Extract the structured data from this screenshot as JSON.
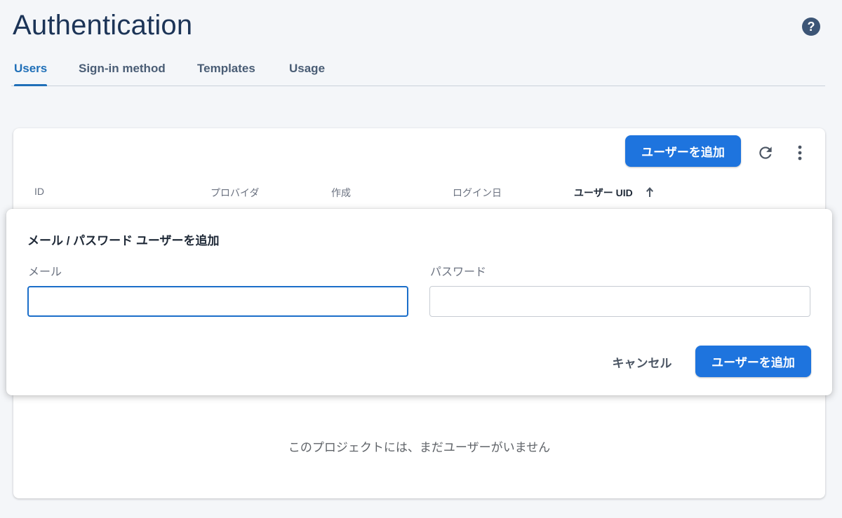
{
  "header": {
    "title": "Authentication",
    "help_icon": "?"
  },
  "tabs": [
    {
      "label": "Users",
      "active": true
    },
    {
      "label": "Sign-in method",
      "active": false
    },
    {
      "label": "Templates",
      "active": false
    },
    {
      "label": "Usage",
      "active": false
    }
  ],
  "toolbar": {
    "add_user_label": "ユーザーを追加"
  },
  "table": {
    "columns": [
      "ID",
      "プロバイダ",
      "作成",
      "ログイン日",
      "ユーザー UID"
    ],
    "sorted_column": "ユーザー UID",
    "empty_message": "このプロジェクトには、まだユーザーがいません"
  },
  "dialog": {
    "title": "メール / パスワード ユーザーを追加",
    "email_label": "メール",
    "email_value": "",
    "password_label": "パスワード",
    "password_value": "",
    "cancel_label": "キャンセル",
    "submit_label": "ユーザーを追加"
  },
  "colors": {
    "accent": "#1e74de",
    "title": "#1c3457",
    "active_tab": "#1f6fb8"
  }
}
